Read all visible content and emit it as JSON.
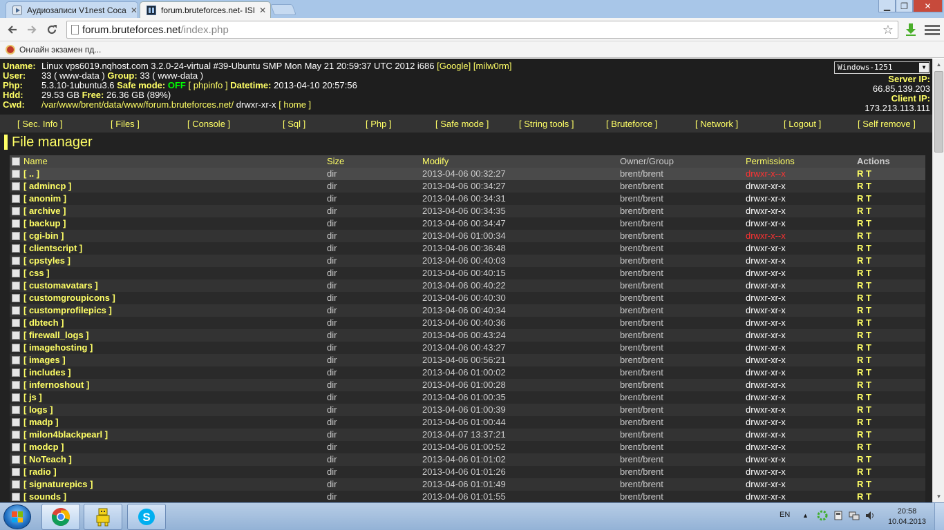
{
  "browser": {
    "tabs": [
      {
        "title": "Аудиозаписи V1nest Соса",
        "active": false
      },
      {
        "title": "forum.bruteforces.net- ISI",
        "active": true
      }
    ],
    "url_host": "forum.bruteforces.net",
    "url_path": "/index.php",
    "bookmark": "Онлайн экзамен пд..."
  },
  "server": {
    "uname_label": "Uname:",
    "uname": "Linux vps6019.nqhost.com 3.2.0-24-virtual #39-Ubuntu SMP Mon May 21 20:59:37 UTC 2012 i686",
    "uname_link1": "[Google]",
    "uname_link2": "[milw0rm]",
    "user_label": "User:",
    "user_value": "33 ( www-data )",
    "group_label": "Group:",
    "group_value": "33 ( www-data )",
    "php_label": "Php:",
    "php_value": "5.3.10-1ubuntu3.6",
    "safe_label": "Safe mode:",
    "safe_value": "OFF",
    "phpinfo_link": "[ phpinfo ]",
    "datetime_label": "Datetime:",
    "datetime_value": "2013-04-10 20:57:56",
    "hdd_label": "Hdd:",
    "hdd_value": "29.53 GB",
    "free_label": "Free:",
    "free_value": "26.36 GB (89%)",
    "cwd_label": "Cwd:",
    "cwd_path": "/var/www/brent/data/www/forum.bruteforces.net/",
    "cwd_perms": "drwxr-xr-x",
    "home_link": "[ home ]",
    "charset": "Windows-1251",
    "server_ip_label": "Server IP:",
    "server_ip": "66.85.139.203",
    "client_ip_label": "Client IP:",
    "client_ip": "173.213.113.111"
  },
  "menu": [
    "[ Sec. Info ]",
    "[ Files ]",
    "[ Console ]",
    "[ Sql ]",
    "[ Php ]",
    "[ Safe mode ]",
    "[ String tools ]",
    "[ Bruteforce ]",
    "[ Network ]",
    "[ Logout ]",
    "[ Self remove ]"
  ],
  "file_manager": {
    "title": "File manager",
    "columns": {
      "name": "Name",
      "size": "Size",
      "modify": "Modify",
      "owner": "Owner/Group",
      "permissions": "Permissions",
      "actions": "Actions"
    },
    "rows": [
      {
        "name": "[ .. ]",
        "size": "dir",
        "modify": "2013-04-06 00:32:27",
        "owner": "brent/brent",
        "perms": "drwxr-x--x",
        "perms_red": true,
        "actions": "R T"
      },
      {
        "name": "[ admincp ]",
        "size": "dir",
        "modify": "2013-04-06 00:34:27",
        "owner": "brent/brent",
        "perms": "drwxr-xr-x",
        "perms_red": false,
        "actions": "R T"
      },
      {
        "name": "[ anonim ]",
        "size": "dir",
        "modify": "2013-04-06 00:34:31",
        "owner": "brent/brent",
        "perms": "drwxr-xr-x",
        "perms_red": false,
        "actions": "R T"
      },
      {
        "name": "[ archive ]",
        "size": "dir",
        "modify": "2013-04-06 00:34:35",
        "owner": "brent/brent",
        "perms": "drwxr-xr-x",
        "perms_red": false,
        "actions": "R T"
      },
      {
        "name": "[ backup ]",
        "size": "dir",
        "modify": "2013-04-06 00:34:47",
        "owner": "brent/brent",
        "perms": "drwxr-xr-x",
        "perms_red": false,
        "actions": "R T"
      },
      {
        "name": "[ cgi-bin ]",
        "size": "dir",
        "modify": "2013-04-06 01:00:34",
        "owner": "brent/brent",
        "perms": "drwxr-x--x",
        "perms_red": true,
        "actions": "R T"
      },
      {
        "name": "[ clientscript ]",
        "size": "dir",
        "modify": "2013-04-06 00:36:48",
        "owner": "brent/brent",
        "perms": "drwxr-xr-x",
        "perms_red": false,
        "actions": "R T"
      },
      {
        "name": "[ cpstyles ]",
        "size": "dir",
        "modify": "2013-04-06 00:40:03",
        "owner": "brent/brent",
        "perms": "drwxr-xr-x",
        "perms_red": false,
        "actions": "R T"
      },
      {
        "name": "[ css ]",
        "size": "dir",
        "modify": "2013-04-06 00:40:15",
        "owner": "brent/brent",
        "perms": "drwxr-xr-x",
        "perms_red": false,
        "actions": "R T"
      },
      {
        "name": "[ customavatars ]",
        "size": "dir",
        "modify": "2013-04-06 00:40:22",
        "owner": "brent/brent",
        "perms": "drwxr-xr-x",
        "perms_red": false,
        "actions": "R T"
      },
      {
        "name": "[ customgroupicons ]",
        "size": "dir",
        "modify": "2013-04-06 00:40:30",
        "owner": "brent/brent",
        "perms": "drwxr-xr-x",
        "perms_red": false,
        "actions": "R T"
      },
      {
        "name": "[ customprofilepics ]",
        "size": "dir",
        "modify": "2013-04-06 00:40:34",
        "owner": "brent/brent",
        "perms": "drwxr-xr-x",
        "perms_red": false,
        "actions": "R T"
      },
      {
        "name": "[ dbtech ]",
        "size": "dir",
        "modify": "2013-04-06 00:40:36",
        "owner": "brent/brent",
        "perms": "drwxr-xr-x",
        "perms_red": false,
        "actions": "R T"
      },
      {
        "name": "[ firewall_logs ]",
        "size": "dir",
        "modify": "2013-04-06 00:43:24",
        "owner": "brent/brent",
        "perms": "drwxr-xr-x",
        "perms_red": false,
        "actions": "R T"
      },
      {
        "name": "[ imagehosting ]",
        "size": "dir",
        "modify": "2013-04-06 00:43:27",
        "owner": "brent/brent",
        "perms": "drwxr-xr-x",
        "perms_red": false,
        "actions": "R T"
      },
      {
        "name": "[ images ]",
        "size": "dir",
        "modify": "2013-04-06 00:56:21",
        "owner": "brent/brent",
        "perms": "drwxr-xr-x",
        "perms_red": false,
        "actions": "R T"
      },
      {
        "name": "[ includes ]",
        "size": "dir",
        "modify": "2013-04-06 01:00:02",
        "owner": "brent/brent",
        "perms": "drwxr-xr-x",
        "perms_red": false,
        "actions": "R T"
      },
      {
        "name": "[ infernoshout ]",
        "size": "dir",
        "modify": "2013-04-06 01:00:28",
        "owner": "brent/brent",
        "perms": "drwxr-xr-x",
        "perms_red": false,
        "actions": "R T"
      },
      {
        "name": "[ js ]",
        "size": "dir",
        "modify": "2013-04-06 01:00:35",
        "owner": "brent/brent",
        "perms": "drwxr-xr-x",
        "perms_red": false,
        "actions": "R T"
      },
      {
        "name": "[ logs ]",
        "size": "dir",
        "modify": "2013-04-06 01:00:39",
        "owner": "brent/brent",
        "perms": "drwxr-xr-x",
        "perms_red": false,
        "actions": "R T"
      },
      {
        "name": "[ madp ]",
        "size": "dir",
        "modify": "2013-04-06 01:00:44",
        "owner": "brent/brent",
        "perms": "drwxr-xr-x",
        "perms_red": false,
        "actions": "R T"
      },
      {
        "name": "[ milon4blackpearl ]",
        "size": "dir",
        "modify": "2013-04-07 13:37:21",
        "owner": "brent/brent",
        "perms": "drwxr-xr-x",
        "perms_red": false,
        "actions": "R T"
      },
      {
        "name": "[ modcp ]",
        "size": "dir",
        "modify": "2013-04-06 01:00:52",
        "owner": "brent/brent",
        "perms": "drwxr-xr-x",
        "perms_red": false,
        "actions": "R T"
      },
      {
        "name": "[ NoTeach ]",
        "size": "dir",
        "modify": "2013-04-06 01:01:02",
        "owner": "brent/brent",
        "perms": "drwxr-xr-x",
        "perms_red": false,
        "actions": "R T"
      },
      {
        "name": "[ radio ]",
        "size": "dir",
        "modify": "2013-04-06 01:01:26",
        "owner": "brent/brent",
        "perms": "drwxr-xr-x",
        "perms_red": false,
        "actions": "R T"
      },
      {
        "name": "[ signaturepics ]",
        "size": "dir",
        "modify": "2013-04-06 01:01:49",
        "owner": "brent/brent",
        "perms": "drwxr-xr-x",
        "perms_red": false,
        "actions": "R T"
      },
      {
        "name": "[ sounds ]",
        "size": "dir",
        "modify": "2013-04-06 01:01:55",
        "owner": "brent/brent",
        "perms": "drwxr-xr-x",
        "perms_red": false,
        "actions": "R T"
      }
    ]
  },
  "taskbar": {
    "language": "EN",
    "time": "20:58",
    "date": "10.04.2013"
  },
  "colors": {
    "accent_yellow": "#ffff66",
    "safe_off_green": "#00ff00",
    "perm_red": "#ff3333",
    "page_bg": "#222222"
  },
  "icons": [
    "media-player-icon",
    "terminal-icon",
    "back-icon",
    "forward-icon",
    "reload-icon",
    "page-icon",
    "star-icon",
    "download-icon",
    "menu-icon",
    "chrome-icon",
    "skype-icon"
  ]
}
